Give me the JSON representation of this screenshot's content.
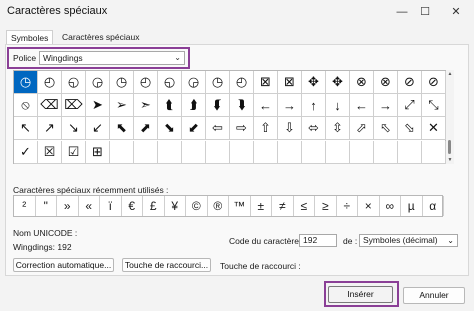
{
  "window": {
    "title": "Caractères spéciaux",
    "minimize_glyph": "—",
    "maximize_glyph": "☐",
    "close_glyph": "✕"
  },
  "tabs": [
    {
      "label": "Symboles",
      "active": true
    },
    {
      "label": "Caractères spéciaux",
      "active": false
    }
  ],
  "font": {
    "label": "Police :",
    "value": "Wingdings"
  },
  "symbol_grid": {
    "rows": [
      [
        "◷",
        "◴",
        "◵",
        "◶",
        "◷",
        "◴",
        "◵",
        "◶",
        "◷",
        "◴",
        "⇱",
        "⇲",
        "⬙",
        "⬘",
        "⇳",
        "⇵",
        "⤡",
        "⤢"
      ],
      [
        "⦸",
        "⌫",
        "⌦",
        "➤",
        "➢",
        "➣",
        "➥",
        "➦",
        "➧",
        "⮐",
        "⮑",
        "⮒",
        "⮓",
        "←",
        "→",
        "↑",
        "↓",
        "⤢"
      ],
      [
        "⬁",
        "⬂",
        "⬃",
        "⬀",
        "⬅",
        "➡",
        "⬆",
        "⬇",
        "⇦",
        "⇨",
        "⇧",
        "⇩",
        "⬄",
        "⇳",
        "⬀",
        "⬁",
        "⬂",
        "⬃"
      ],
      [
        "⌗",
        "⎔",
        "✓",
        "☒",
        "☑",
        "⊞",
        "",
        "",
        "",
        "",
        "",
        "",
        "",
        "",
        "",
        "",
        "",
        ""
      ]
    ],
    "display_rows": [
      [
        "◷",
        "◴",
        "◵",
        "◶",
        "◷",
        "◴",
        "◵",
        "◶",
        "◷",
        "◴",
        "◩",
        "◪",
        "⊠",
        "⊠",
        "⊗",
        "⊗",
        "⊘",
        "⊘"
      ],
      [
        "⦸",
        "⌫",
        "⌦",
        "➤",
        "➢",
        "➣",
        "⮌",
        "⮍",
        "⮎",
        "⮏",
        "⮐",
        "⮑",
        "⮒",
        "←",
        "→",
        "↑",
        "↓",
        "⤢"
      ],
      [
        "⤡",
        "⤢",
        "⤣",
        "⤤",
        "→",
        "↑",
        "↓",
        "⬉",
        "⬈",
        "⬊",
        "⬋",
        "⇦",
        "⇨",
        "⇧",
        "⇩",
        "⇔",
        "⇕",
        "✕"
      ],
      [
        "✓",
        "☒",
        "☑",
        "⊞",
        "",
        "",
        "",
        "",
        "",
        "",
        "",
        "",
        "",
        "",
        "",
        "",
        "",
        ""
      ]
    ],
    "selected_index": 0
  },
  "grid_render": [
    [
      "🕐",
      "🕑",
      "🕒",
      "🕓",
      "🕔",
      "🕕",
      "🕖",
      "🕗",
      "🕘",
      "🕙",
      "⊠",
      "⊠",
      "⊛",
      "⊛",
      "⊗",
      "⊗",
      "⊘",
      "⊘"
    ],
    [
      "⦸",
      "⌫",
      "⌦",
      "➤",
      "➢",
      "➣",
      "⮌",
      "⮍",
      "⮎",
      "⮏",
      "⬅",
      "➡",
      "⬆",
      "⬇",
      "←",
      "→",
      "↑",
      "↓"
    ],
    [
      "🡔",
      "🡕",
      "🡖",
      "🡗",
      "🡔",
      "🡕",
      "🡖",
      "🡗",
      "⇦",
      "⇨",
      "⇧",
      "⇩",
      "⬄",
      "⇳",
      "⬀",
      "⬁",
      "⬂",
      "✕"
    ],
    [
      "✓",
      "☒",
      "☑",
      "⊞",
      "",
      "",
      "",
      "",
      "",
      "",
      "",
      "",
      "",
      "",
      "",
      "",
      "",
      ""
    ]
  ],
  "grid_cells": {
    "r0": [
      "◷",
      "◴",
      "◵",
      "◶",
      "◷",
      "◴",
      "◵",
      "◶",
      "◷",
      "◴",
      "⊠",
      "⊠",
      "✥",
      "✥",
      "⊗",
      "⊗",
      "⊘",
      "⊘"
    ],
    "r1": [
      "⦸",
      "⌫",
      "⌦",
      "➤",
      "➢",
      "➣",
      "⮬",
      "⮭",
      "⮮",
      "⮯",
      "←",
      "→",
      "↑",
      "↓",
      "←",
      "→",
      "⤢",
      "⤡"
    ],
    "r2": [
      "↖",
      "↗",
      "↘",
      "↙",
      "⬉",
      "⬈",
      "⬊",
      "⬋",
      "⇦",
      "⇨",
      "⇧",
      "⇩",
      "⬄",
      "⇳",
      "⬀",
      "⬁",
      "⬂",
      "✕"
    ],
    "r3": [
      "✓",
      "☒",
      "☑",
      "⊞",
      "",
      "",
      "",
      "",
      "",
      "",
      "",
      "",
      "",
      "",
      "",
      "",
      "",
      ""
    ]
  },
  "recent": {
    "label": "Caractères spéciaux récemment utilisés :",
    "chars": [
      "²",
      "\"",
      "»",
      "«",
      "ï",
      "€",
      "£",
      "¥",
      "©",
      "®",
      "™",
      "±",
      "≠",
      "≤",
      "≥",
      "÷",
      "×",
      "∞",
      "µ",
      "α"
    ]
  },
  "info": {
    "unicode_name_label": "Nom UNICODE :",
    "font_code_label": "Wingdings: 192",
    "char_code_label": "Code du caractère :",
    "char_code_value": "192",
    "from_label": "de :",
    "from_value": "Symboles (décimal)",
    "autocorrect_button": "Correction automatique...",
    "shortcut_key_button": "Touche de raccourci...",
    "shortcut_key_label": "Touche de raccourci :"
  },
  "footer": {
    "insert_button": "Insérer",
    "cancel_button": "Annuler"
  },
  "colors": {
    "accent": "#0067c0",
    "highlight_frame": "#8a3f96"
  }
}
